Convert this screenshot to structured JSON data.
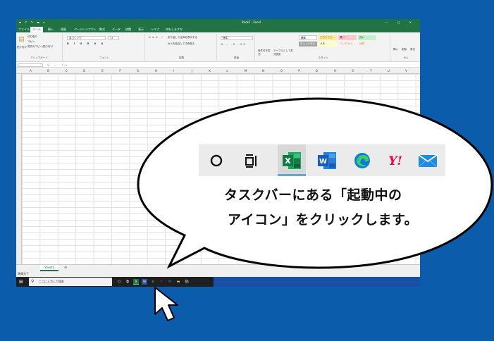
{
  "excel": {
    "window_title": "Book1 - Excel",
    "menu": [
      "ファイル",
      "ホーム",
      "挿入",
      "描画",
      "ページレイアウト",
      "数式",
      "データ",
      "校閲",
      "表示",
      "ヘルプ",
      "何をしますか"
    ],
    "active_menu_index": 1,
    "clipboard": {
      "cut": "切り取り",
      "copy": "コピー",
      "format_painter": "書式のコピー/貼り付け",
      "paste": "貼り付け",
      "label": "クリップボード"
    },
    "font": {
      "name": "游ゴシック",
      "size": "11",
      "label": "フォント"
    },
    "alignment": {
      "wrap": "折り返して全体を表示する",
      "merge": "セルを結合して中央揃え",
      "label": "配置"
    },
    "number": {
      "format": "標準",
      "label": "数値"
    },
    "styles": {
      "conditional": "条件付き書式",
      "table": "テーブルとして書式設定",
      "label": "スタイル",
      "cells": [
        "標準",
        "どちらでも...",
        "悪い",
        "良い",
        "チェックセル",
        "メモ",
        "リンク セル",
        "計算"
      ]
    },
    "cells_group": {
      "insert": "挿入",
      "delete": "削除",
      "format": "書式",
      "label": "セル"
    },
    "formula_fx": "fx",
    "columns": [
      "A",
      "B",
      "C",
      "D",
      "E",
      "F",
      "G",
      "H",
      "I",
      "J",
      "K",
      "L",
      "M",
      "N",
      "O",
      "P",
      "Q",
      "R",
      "S",
      "T",
      "U",
      "V"
    ],
    "sheet_tab": "Sheet1",
    "status": "準備完了",
    "taskbar_search": "ここに入力して検索",
    "accent": "#217346"
  },
  "callout": {
    "icons": [
      "cortana-circle-icon",
      "task-view-icon",
      "excel-icon",
      "word-icon",
      "edge-icon",
      "yahoo-icon",
      "mail-icon"
    ],
    "line1": "タスクバーにある「起動中の",
    "line2": "アイコン」をクリックします。"
  },
  "colors": {
    "background": "#0b5cab",
    "excel_green": "#217346",
    "word_blue": "#2b579a"
  }
}
